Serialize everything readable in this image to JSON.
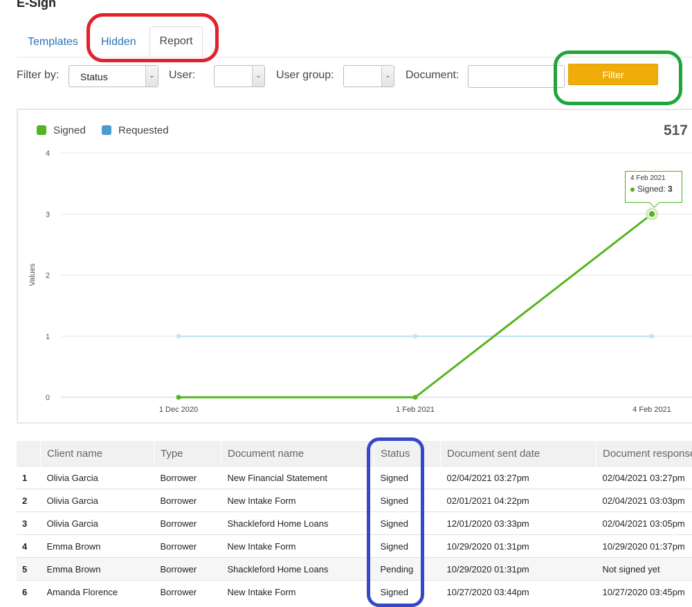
{
  "app": {
    "title": "E-Sign"
  },
  "tabs": [
    {
      "label": "Templates"
    },
    {
      "label": "Hidden"
    },
    {
      "label": "Report"
    }
  ],
  "filters": {
    "filter_by_label": "Filter by:",
    "filter_by_value": "Status",
    "user_label": "User:",
    "user_value": "",
    "user_group_label": "User group:",
    "user_group_value": "",
    "document_label": "Document:",
    "document_value": "",
    "filter_button": "Filter"
  },
  "chart": {
    "total": "517",
    "tooltip": {
      "date": "4 Feb 2021",
      "series": "Signed:",
      "value": "3"
    }
  },
  "colors": {
    "signed": "#55b41e",
    "requested": "#4a9ad4",
    "accent": "#f0ad0a",
    "link": "#2a74b5"
  },
  "chart_data": {
    "type": "line",
    "x": [
      "1 Dec 2020",
      "1 Feb 2021",
      "4 Feb 2021"
    ],
    "series": [
      {
        "name": "Signed",
        "values": [
          0,
          0,
          3
        ],
        "color": "#55b41e"
      },
      {
        "name": "Requested",
        "values": [
          1,
          1,
          1
        ],
        "color": "#4a9ad4"
      }
    ],
    "ylabel": "Values",
    "ylim": [
      0,
      4
    ],
    "yticks": [
      0,
      1,
      2,
      3,
      4
    ],
    "grid": true,
    "legend": "top-left"
  },
  "table": {
    "columns": [
      "",
      "Client name",
      "Type",
      "Document name",
      "Status",
      "Document sent date",
      "Document response"
    ],
    "rows": [
      {
        "num": "1",
        "client": "Olivia Garcia",
        "type": "Borrower",
        "document": "New Financial Statement",
        "status": "Signed",
        "sent": "02/04/2021 03:27pm",
        "response": "02/04/2021 03:27pm"
      },
      {
        "num": "2",
        "client": "Olivia Garcia",
        "type": "Borrower",
        "document": "New Intake Form",
        "status": "Signed",
        "sent": "02/01/2021 04:22pm",
        "response": "02/04/2021 03:03pm"
      },
      {
        "num": "3",
        "client": "Olivia Garcia",
        "type": "Borrower",
        "document": "Shackleford Home Loans",
        "status": "Signed",
        "sent": "12/01/2020 03:33pm",
        "response": "02/04/2021 03:05pm"
      },
      {
        "num": "4",
        "client": "Emma Brown",
        "type": "Borrower",
        "document": "New Intake Form",
        "status": "Signed",
        "sent": "10/29/2020 01:31pm",
        "response": "10/29/2020 01:37pm"
      },
      {
        "num": "5",
        "client": "Emma Brown",
        "type": "Borrower",
        "document": "Shackleford Home Loans",
        "status": "Pending",
        "sent": "10/29/2020 01:31pm",
        "response": "Not signed yet"
      },
      {
        "num": "6",
        "client": "Amanda Florence",
        "type": "Borrower",
        "document": "New Intake Form",
        "status": "Signed",
        "sent": "10/27/2020 03:44pm",
        "response": "10/27/2020 03:45pm"
      }
    ]
  }
}
